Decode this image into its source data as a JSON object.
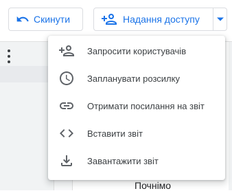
{
  "toolbar": {
    "reset_label": "Скинути",
    "share_label": "Надання доступу"
  },
  "menu": {
    "items": [
      {
        "label": "Запросити користувачів",
        "icon": "person-add-icon"
      },
      {
        "label": "Запланувати розсилку",
        "icon": "clock-icon"
      },
      {
        "label": "Отримати посилання на звіт",
        "icon": "link-icon"
      },
      {
        "label": "Вставити звіт",
        "icon": "code-icon"
      },
      {
        "label": "Завантажити звіт",
        "icon": "download-icon"
      }
    ]
  },
  "background": {
    "partial_text": "Почнімо"
  },
  "colors": {
    "accent": "#1a73e8",
    "icon": "#5f6368",
    "text": "#3c4043"
  }
}
